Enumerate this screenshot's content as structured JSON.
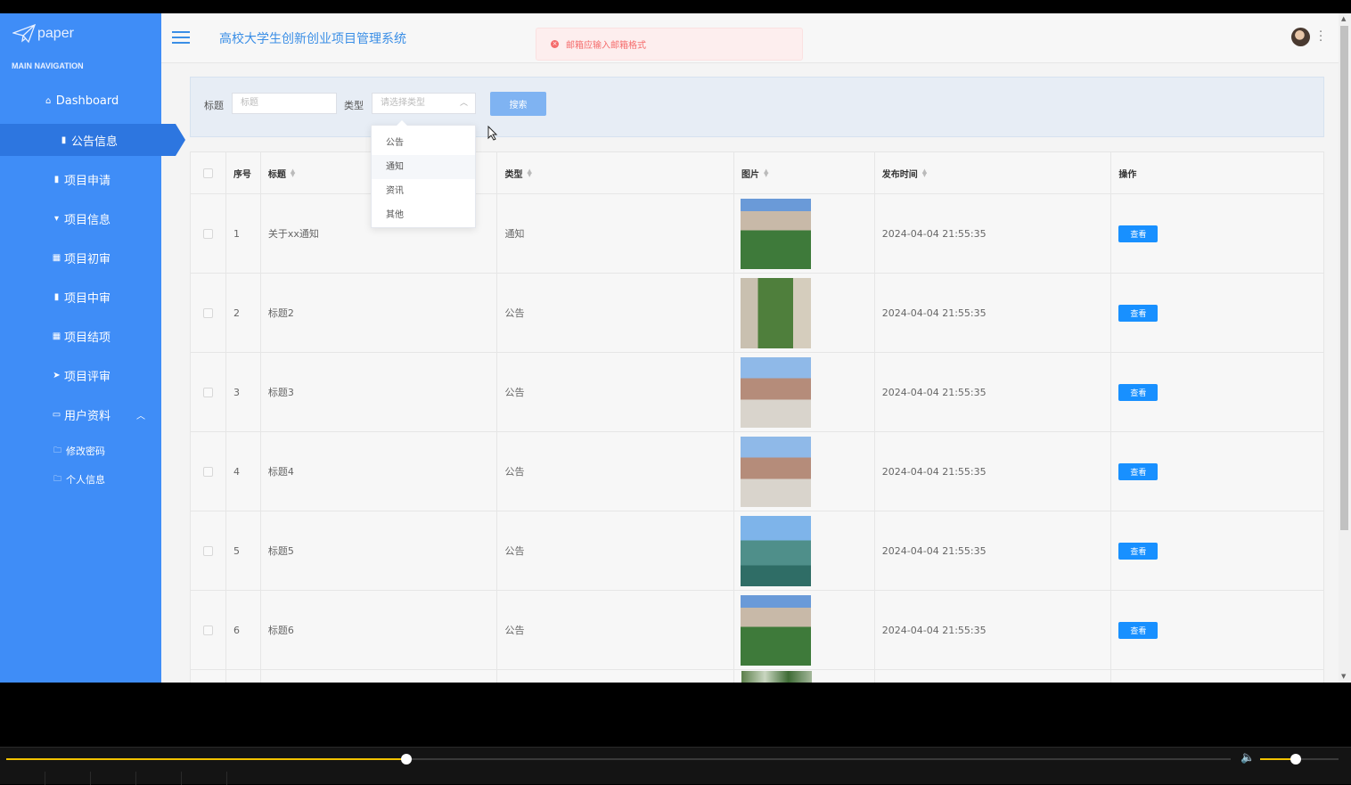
{
  "app": {
    "logo_text": "paper",
    "title": "高校大学生创新创业项目管理系统",
    "toast": "邮箱应输入邮箱格式"
  },
  "sidebar": {
    "caption": "MAIN NAVIGATION",
    "items": [
      {
        "label": "Dashboard",
        "icon": "home-icon"
      },
      {
        "label": "公告信息",
        "icon": "clipboard-icon",
        "active": true
      },
      {
        "label": "项目申请",
        "icon": "clipboard-check-icon"
      },
      {
        "label": "项目信息",
        "icon": "bookmark-icon"
      },
      {
        "label": "项目初审",
        "icon": "grid-icon"
      },
      {
        "label": "项目中审",
        "icon": "clipboard-icon"
      },
      {
        "label": "项目结项",
        "icon": "grid-icon"
      },
      {
        "label": "项目评审",
        "icon": "send-icon"
      },
      {
        "label": "用户资料",
        "icon": "window-icon",
        "expanded": true
      }
    ],
    "sub_items": [
      {
        "label": "修改密码",
        "icon": "folder-icon"
      },
      {
        "label": "个人信息",
        "icon": "folder-icon"
      }
    ]
  },
  "search": {
    "title_label": "标题",
    "title_placeholder": "标题",
    "type_label": "类型",
    "type_placeholder": "请选择类型",
    "button": "搜索",
    "type_options": [
      "公告",
      "通知",
      "资讯",
      "其他"
    ],
    "hovered_option": "通知"
  },
  "table": {
    "headers": [
      "序号",
      "标题",
      "类型",
      "图片",
      "发布时间",
      "操作"
    ],
    "rows": [
      {
        "no": "1",
        "title": "关于xx通知",
        "type": "通知",
        "time": "2024-04-04 21:55:35",
        "action": "查看"
      },
      {
        "no": "2",
        "title": "标题2",
        "type": "公告",
        "time": "2024-04-04 21:55:35",
        "action": "查看"
      },
      {
        "no": "3",
        "title": "标题3",
        "type": "公告",
        "time": "2024-04-04 21:55:35",
        "action": "查看"
      },
      {
        "no": "4",
        "title": "标题4",
        "type": "公告",
        "time": "2024-04-04 21:55:35",
        "action": "查看"
      },
      {
        "no": "5",
        "title": "标题5",
        "type": "公告",
        "time": "2024-04-04 21:55:35",
        "action": "查看"
      },
      {
        "no": "6",
        "title": "标题6",
        "type": "公告",
        "time": "2024-04-04 21:55:35",
        "action": "查看"
      }
    ]
  },
  "player": {
    "progress": 0.327,
    "volume": 0.45
  },
  "colors": {
    "sidebar": "#3f8df7",
    "accent": "#1890ff",
    "toast_text": "#f56c6c"
  }
}
